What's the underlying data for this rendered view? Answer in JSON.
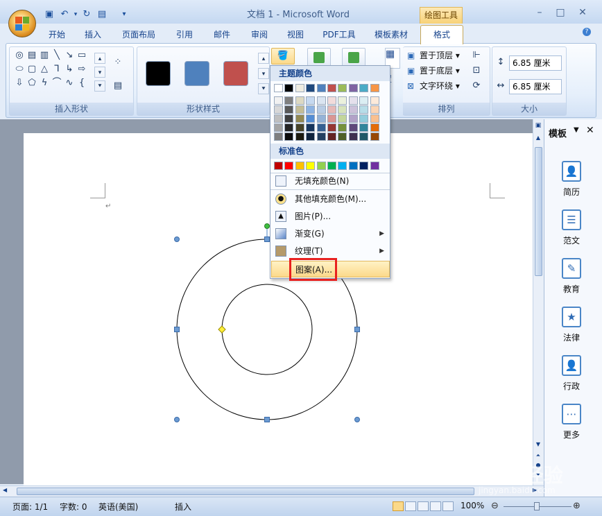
{
  "window": {
    "title": "文档 1 - Microsoft Word",
    "contextual_tab": "绘图工具"
  },
  "tabs": [
    "开始",
    "插入",
    "页面布局",
    "引用",
    "邮件",
    "审阅",
    "视图",
    "PDF工具",
    "模板素材",
    "格式"
  ],
  "ribbon": {
    "groups": {
      "insert_shapes": "插入形状",
      "shape_styles": "形状样式",
      "arrange": "排列",
      "size": "大小"
    },
    "arrange_items": {
      "bring_front": "置于顶层",
      "send_back": "置于底层",
      "text_wrap": "文字环绕",
      "position": "置"
    },
    "size": {
      "height": "6.85 厘米",
      "width": "6.85 厘米"
    },
    "style_colors": [
      "#000000",
      "#4f81bd",
      "#c0504d"
    ]
  },
  "fill_menu": {
    "theme_colors_header": "主题颜色",
    "standard_colors_header": "标准色",
    "theme_top": [
      "#ffffff",
      "#000000",
      "#eeece1",
      "#1f497d",
      "#4f81bd",
      "#c0504d",
      "#9bbb59",
      "#8064a2",
      "#4bacc6",
      "#f79646"
    ],
    "theme_shades": [
      [
        "#f2f2f2",
        "#d8d8d8",
        "#bfbfbf",
        "#a5a5a5",
        "#7f7f7f"
      ],
      [
        "#7f7f7f",
        "#595959",
        "#3f3f3f",
        "#262626",
        "#0c0c0c"
      ],
      [
        "#ddd9c3",
        "#c4bd97",
        "#938953",
        "#494429",
        "#1d1b10"
      ],
      [
        "#c6d9f0",
        "#8db3e2",
        "#548dd4",
        "#17365d",
        "#0f243e"
      ],
      [
        "#dbe5f1",
        "#b8cce4",
        "#95b3d7",
        "#366092",
        "#244061"
      ],
      [
        "#f2dcdb",
        "#e5b9b7",
        "#d99694",
        "#953734",
        "#632423"
      ],
      [
        "#ebf1dd",
        "#d7e3bc",
        "#c3d69b",
        "#76923c",
        "#4f6128"
      ],
      [
        "#e5e0ec",
        "#ccc1d9",
        "#b2a2c7",
        "#5f497a",
        "#3f3151"
      ],
      [
        "#dbeef3",
        "#b7dde8",
        "#92cddc",
        "#31859b",
        "#205867"
      ],
      [
        "#fdeada",
        "#fbd5b5",
        "#fac08f",
        "#e36c09",
        "#974806"
      ]
    ],
    "standard": [
      "#c00000",
      "#ff0000",
      "#ffc000",
      "#ffff00",
      "#92d050",
      "#00b050",
      "#00b0f0",
      "#0070c0",
      "#002060",
      "#7030a0"
    ],
    "items": {
      "no_fill": "无填充颜色(N)",
      "more_colors": "其他填充颜色(M)...",
      "picture": "图片(P)...",
      "gradient": "渐变(G)",
      "texture": "纹理(T)",
      "pattern": "图案(A)..."
    }
  },
  "sidepanel": {
    "title": "模板",
    "items": [
      "简历",
      "范文",
      "教育",
      "法律",
      "行政",
      "更多"
    ]
  },
  "status": {
    "page": "页面: 1/1",
    "words": "字数: 0",
    "language": "英语(美国)",
    "mode": "插入",
    "zoom": "100%"
  },
  "watermark": {
    "brand": "Baidu经验",
    "url": "jingyan.baidu.com"
  }
}
